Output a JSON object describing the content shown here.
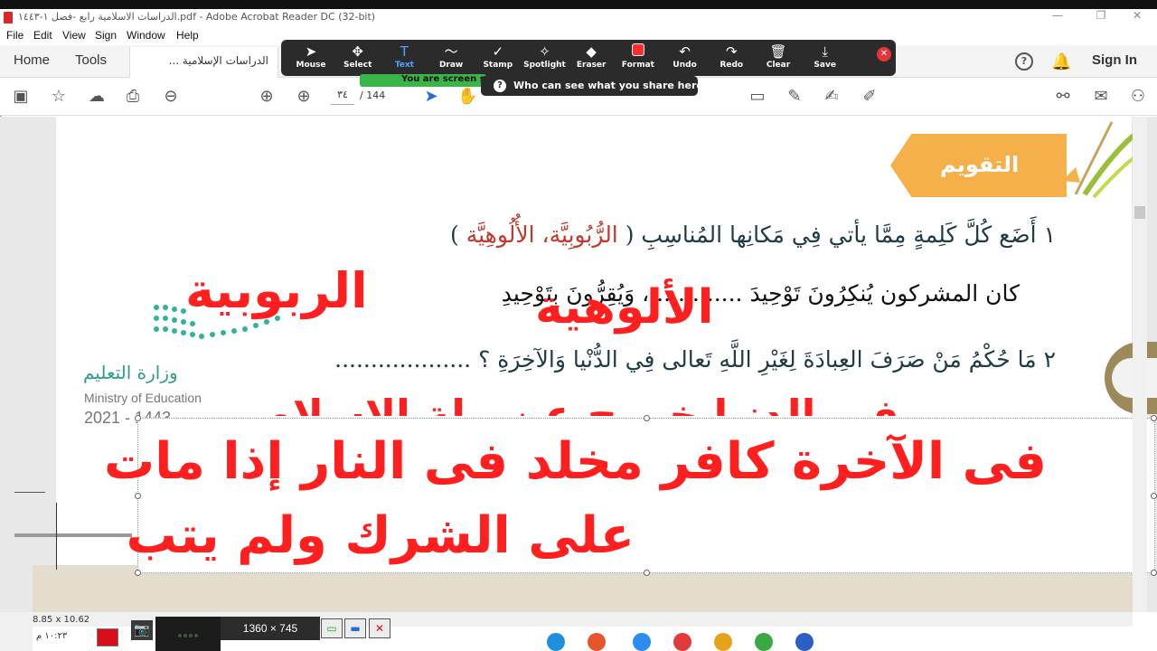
{
  "window": {
    "title": "الدراسات الاسلامية رابع -فصل ١-١٤٤٣.pdf - Adobe Acrobat Reader DC (32-bit)",
    "min": "—",
    "restore": "❐",
    "close": "✕"
  },
  "menu": [
    "File",
    "Edit",
    "View",
    "Sign",
    "Window",
    "Help"
  ],
  "tabs": {
    "home": "Home",
    "tools": "Tools",
    "document": "الدراسات الإسلامية ...",
    "document_close": "✕",
    "sign_in": "Sign In"
  },
  "toolbar": {
    "page_current": "٣٤",
    "page_total": "/ 144"
  },
  "zoom_annotate": {
    "tools": [
      {
        "label": "Mouse",
        "icon": "cursor-icon",
        "glyph": "➤"
      },
      {
        "label": "Select",
        "icon": "move-icon",
        "glyph": "✥"
      },
      {
        "label": "Text",
        "icon": "text-icon",
        "glyph": "T"
      },
      {
        "label": "Draw",
        "icon": "draw-icon",
        "glyph": "〜"
      },
      {
        "label": "Stamp",
        "icon": "check-icon",
        "glyph": "✓"
      },
      {
        "label": "Spotlight",
        "icon": "wand-icon",
        "glyph": "✧"
      },
      {
        "label": "Eraser",
        "icon": "eraser-icon",
        "glyph": "◆"
      },
      {
        "label": "Format",
        "icon": "format-color-icon",
        "glyph": ""
      },
      {
        "label": "Undo",
        "icon": "undo-icon",
        "glyph": "↶"
      },
      {
        "label": "Redo",
        "icon": "redo-icon",
        "glyph": "↷"
      },
      {
        "label": "Clear",
        "icon": "trash-icon",
        "glyph": "🗑"
      },
      {
        "label": "Save",
        "icon": "save-icon",
        "glyph": "⤓"
      }
    ],
    "active_tool": "Text",
    "format_color": "#ff2d2d",
    "sharing_notice": "You are screen s",
    "who_share": "Who can see what you share here?"
  },
  "document": {
    "section_title": "التقويم",
    "q1_num": "١",
    "q1_text": "أَضَع كُلَّ كَلِمةٍ مِمَّا يأتي فِي مَكانِها المُناسِبِ (",
    "q1_options": "الرُّبُوبِيَّة، الأُلُوهِيَّة",
    "q1_close": ")",
    "q1_sentence": "كان المشركون يُنكِرُونَ تَوْحِيدَ ............ ، وَيُقِرُّونَ بِتَوْحِيدِ",
    "q2_num": "٢",
    "q2_text": "مَا حُكْمُ مَنْ صَرَفَ العِبادَةَ لِغَيْرِ اللَّهِ تَعالى فِي الدُّنْيا وَالآخِرَةِ ؟ ...................",
    "moe_ar": "وزارة التعليم",
    "moe_en": "Ministry of Education",
    "moe_year": "2021 - 1443"
  },
  "annotations": {
    "rububiyya": "الربوبية",
    "uluhiyya": "الألوهية",
    "partial": "في الدنيا خروج عن ملة الإسلام",
    "textbox_line1": "فى الآخرة كافر مخلد فى النار إذا مات",
    "textbox_line2": "على الشرك ولم يتب",
    "color": "#ff1f1f"
  },
  "status": {
    "page_size": "8.85 x 10.62",
    "clock": "١٠:٢٣ م",
    "resolution": "1360 × 745"
  }
}
